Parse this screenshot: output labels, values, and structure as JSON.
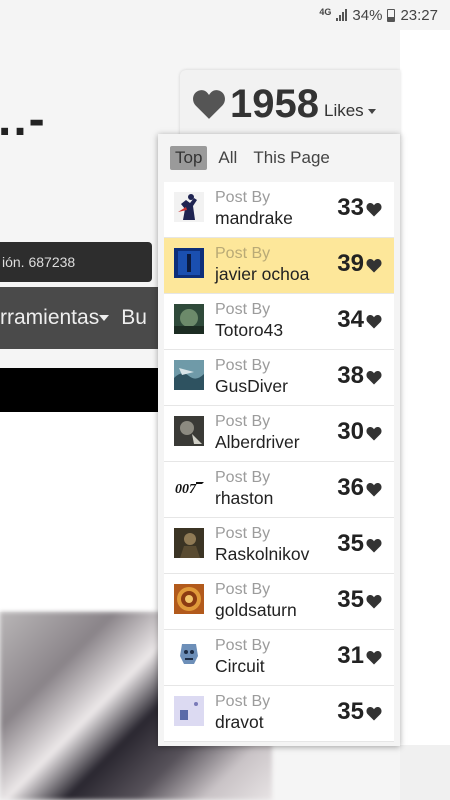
{
  "status_bar": {
    "network": "4G",
    "battery": "34%",
    "time": "23:27"
  },
  "background_page": {
    "title_fragment": "..-",
    "tooltip_text": "ión. 687238",
    "menu_item": "rramientas",
    "menu_item_next": "Bu"
  },
  "likes": {
    "count": "1958",
    "label": "Likes"
  },
  "filters": [
    "Top",
    "All",
    "This Page"
  ],
  "post_by_label": "Post By",
  "items": [
    {
      "user": "mandrake",
      "score": "33",
      "avatar": "figure-avatar",
      "highlight": false
    },
    {
      "user": "javier ochoa",
      "score": "39",
      "avatar": "blue-avatar",
      "highlight": true
    },
    {
      "user": "Totoro43",
      "score": "34",
      "avatar": "green-avatar",
      "highlight": false
    },
    {
      "user": "GusDiver",
      "score": "38",
      "avatar": "ocean-avatar",
      "highlight": false
    },
    {
      "user": "Alberdriver",
      "score": "30",
      "avatar": "dark-avatar",
      "highlight": false
    },
    {
      "user": "rhaston",
      "score": "36",
      "avatar": "007-logo",
      "highlight": false
    },
    {
      "user": "Raskolnikov",
      "score": "35",
      "avatar": "portrait-avatar",
      "highlight": false
    },
    {
      "user": "goldsaturn",
      "score": "35",
      "avatar": "mandala-avatar",
      "highlight": false
    },
    {
      "user": "Circuit",
      "score": "31",
      "avatar": "robot-avatar",
      "highlight": false
    },
    {
      "user": "dravot",
      "score": "35",
      "avatar": "sketch-avatar",
      "highlight": false
    }
  ]
}
